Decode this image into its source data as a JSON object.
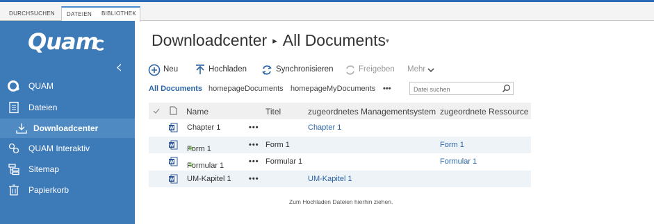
{
  "ribbon": {
    "tabs": [
      "DURCHSUCHEN",
      "DATEIEN",
      "BIBLIOTHEK"
    ]
  },
  "sidebar": {
    "logo": "Quam",
    "items": [
      {
        "label": "QUAM",
        "icon": "quam-logo-icon"
      },
      {
        "label": "Dateien",
        "icon": "documents-icon"
      },
      {
        "label": "Downloadcenter",
        "icon": "download-icon"
      },
      {
        "label": "QUAM Interaktiv",
        "icon": "interactive-icon"
      },
      {
        "label": "Sitemap",
        "icon": "sitemap-icon"
      },
      {
        "label": "Papierkorb",
        "icon": "trash-icon"
      }
    ]
  },
  "page": {
    "site": "Downloadcenter",
    "separator": "▸",
    "view": "All Documents"
  },
  "commands": {
    "new": "Neu",
    "upload": "Hochladen",
    "sync": "Synchronisieren",
    "share": "Freigeben",
    "more": "Mehr"
  },
  "views": {
    "items": [
      "All Documents",
      "homepageDocuments",
      "homepageMyDocuments"
    ],
    "more": "•••"
  },
  "search": {
    "placeholder": "Datei suchen"
  },
  "table": {
    "headers": [
      "Name",
      "Titel",
      "zugeordnetes Managementsystem",
      "zugeordnete Ressource"
    ],
    "rows": [
      {
        "name": "Chapter 1",
        "new": false,
        "menu": "•••",
        "title": "",
        "system": "Chapter 1",
        "resource": ""
      },
      {
        "name": "Form 1",
        "new": true,
        "menu": "•••",
        "title": "Form 1",
        "system": "",
        "resource": "Form 1"
      },
      {
        "name": "Formular 1",
        "new": true,
        "menu": "•••",
        "title": "Formular 1",
        "system": "",
        "resource": "Formular 1"
      },
      {
        "name": "UM-Kapitel 1",
        "new": false,
        "menu": "•••",
        "title": "",
        "system": "UM-Kapitel 1",
        "resource": ""
      }
    ],
    "new_mark": "✲"
  },
  "dropzone": "Zum Hochladen Dateien hierhin ziehen.",
  "colors": {
    "accent": "#3d7ab8",
    "link": "#2a64a6",
    "sidebar_active": "#4f8ac3"
  }
}
